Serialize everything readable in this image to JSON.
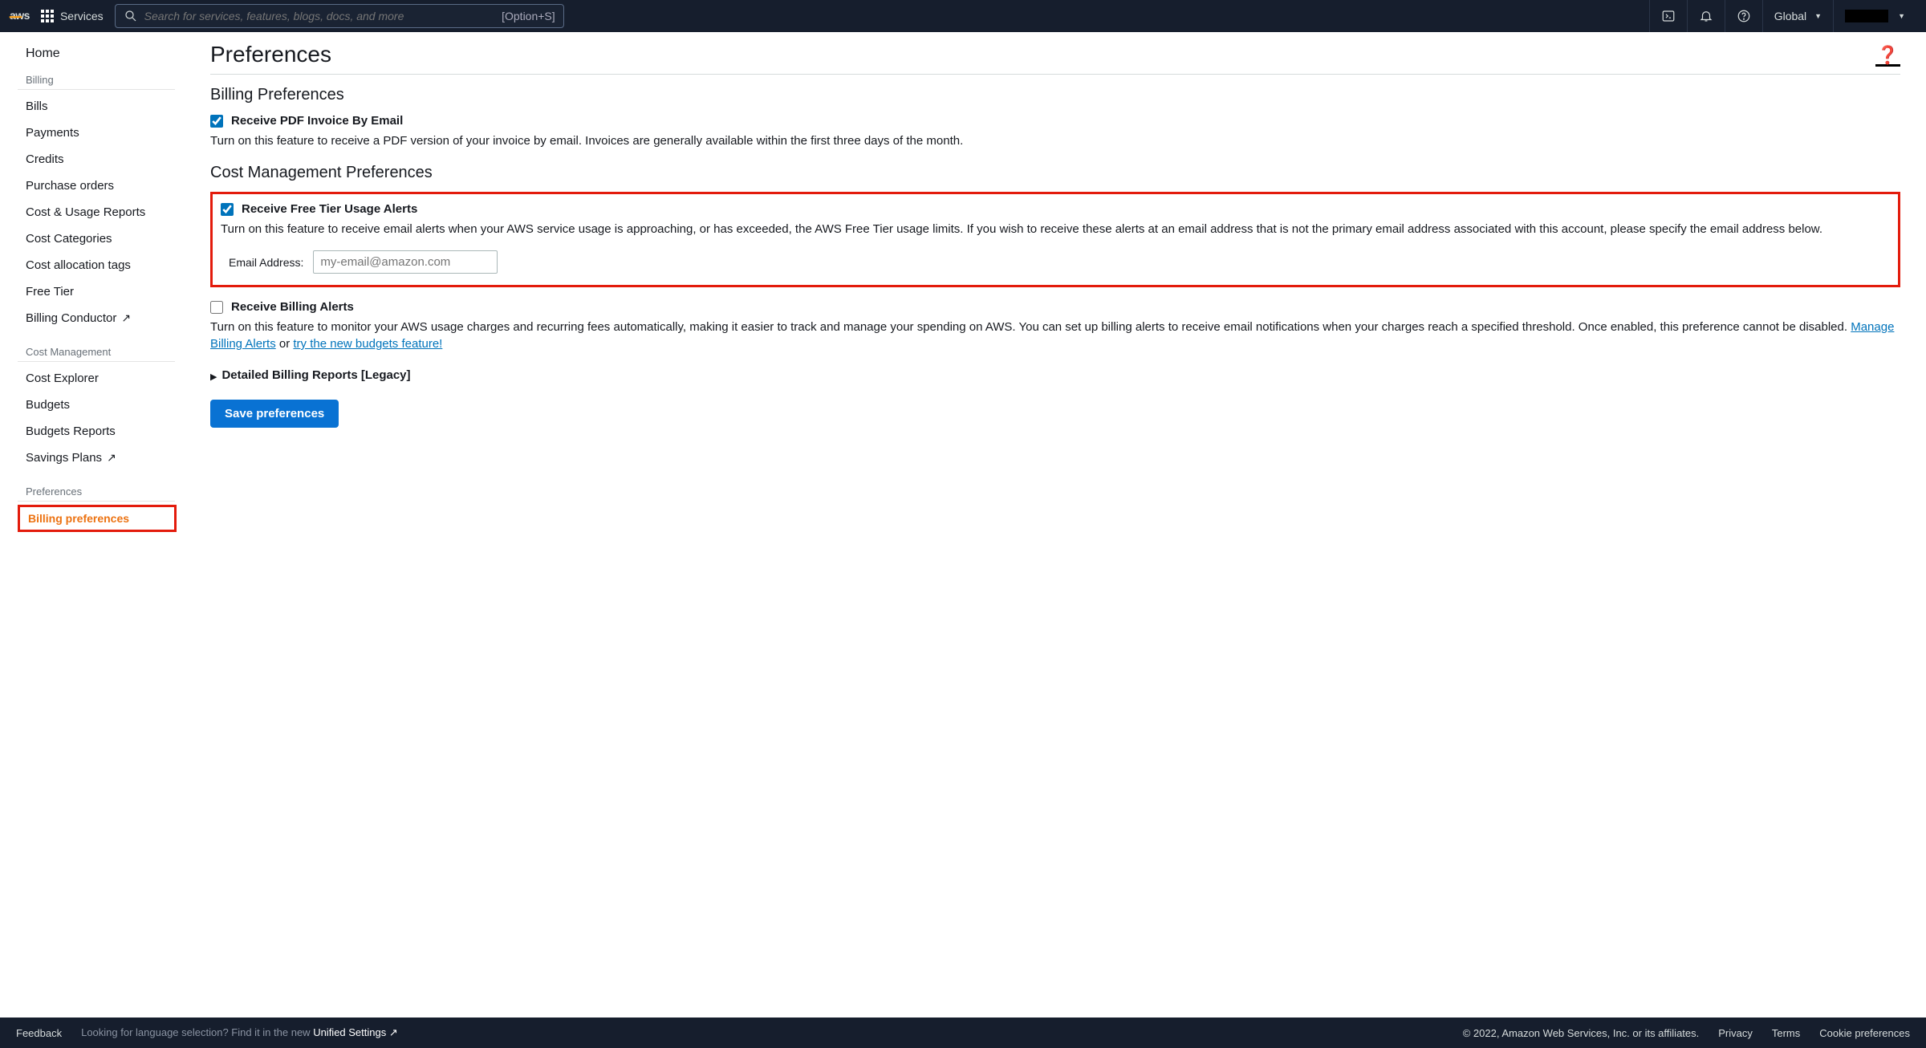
{
  "topnav": {
    "logo_text": "aws",
    "services_label": "Services",
    "search_placeholder": "Search for services, features, blogs, docs, and more",
    "search_shortcut": "[Option+S]",
    "region": "Global"
  },
  "sidebar": {
    "home": "Home",
    "cat_billing": "Billing",
    "items_billing": [
      "Bills",
      "Payments",
      "Credits",
      "Purchase orders",
      "Cost & Usage Reports",
      "Cost Categories",
      "Cost allocation tags",
      "Free Tier",
      "Billing Conductor"
    ],
    "cat_costmgmt": "Cost Management",
    "items_costmgmt": [
      "Cost Explorer",
      "Budgets",
      "Budgets Reports",
      "Savings Plans"
    ],
    "cat_prefs": "Preferences",
    "items_prefs": [
      "Billing preferences"
    ]
  },
  "main": {
    "title": "Preferences",
    "billing_heading": "Billing Preferences",
    "pdf": {
      "label": "Receive PDF Invoice By Email",
      "desc": "Turn on this feature to receive a PDF version of your invoice by email. Invoices are generally available within the first three days of the month.",
      "checked": true
    },
    "costmgmt_heading": "Cost Management Preferences",
    "freetier": {
      "label": "Receive Free Tier Usage Alerts",
      "desc": "Turn on this feature to receive email alerts when your AWS service usage is approaching, or has exceeded, the AWS Free Tier usage limits. If you wish to receive these alerts at an email address that is not the primary email address associated with this account, please specify the email address below.",
      "checked": true,
      "email_label": "Email Address:",
      "email_placeholder": "my-email@amazon.com"
    },
    "billingalerts": {
      "label": "Receive Billing Alerts",
      "desc_pre": "Turn on this feature to monitor your AWS usage charges and recurring fees automatically, making it easier to track and manage your spending on AWS. You can set up billing alerts to receive email notifications when your charges reach a specified threshold. Once enabled, this preference cannot be disabled. ",
      "link1": "Manage Billing Alerts",
      "sep": " or ",
      "link2": "try the new budgets feature!",
      "checked": false
    },
    "legacy_label": "Detailed Billing Reports [Legacy]",
    "save_button": "Save preferences"
  },
  "footer": {
    "feedback": "Feedback",
    "lang_pre": "Looking for language selection? Find it in the new ",
    "lang_link": "Unified Settings",
    "copyright": "© 2022, Amazon Web Services, Inc. or its affiliates.",
    "privacy": "Privacy",
    "terms": "Terms",
    "cookie": "Cookie preferences"
  }
}
